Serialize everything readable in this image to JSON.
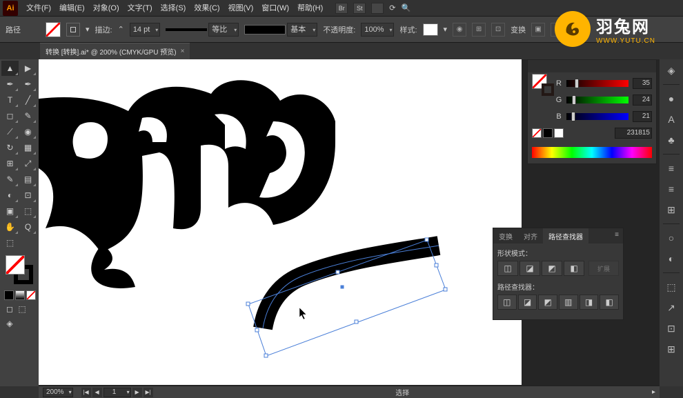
{
  "app_icon": "Ai",
  "menu": [
    "文件(F)",
    "编辑(E)",
    "对象(O)",
    "文字(T)",
    "选择(S)",
    "效果(C)",
    "视图(V)",
    "窗口(W)",
    "帮助(H)"
  ],
  "menu_extra_labels": [
    "Br",
    "St"
  ],
  "options": {
    "label": "路径",
    "stroke_label": "描边:",
    "stroke_weight": "14 pt",
    "profile_label": "等比",
    "brush_label": "基本",
    "opacity_label": "不透明度:",
    "opacity_value": "100%",
    "style_label": "样式:",
    "transform_label": "变换"
  },
  "tab": {
    "title": "转换  [转换].ai* @ 200% (CMYK/GPU 预览)",
    "close": "×"
  },
  "tools": [
    [
      "▲",
      "▶"
    ],
    [
      "✒",
      "✒"
    ],
    [
      "T",
      "╱"
    ],
    [
      "◻",
      "✎"
    ],
    [
      "⟋",
      "◉"
    ],
    [
      "↻",
      "▦"
    ],
    [
      "⊞",
      "⤢"
    ],
    [
      "✎",
      "▤"
    ],
    [
      "◐",
      "⊡"
    ],
    [
      "▣",
      "⬚"
    ],
    [
      "✋",
      "Q"
    ],
    [
      "⬚",
      ""
    ]
  ],
  "toolbox_small": {
    "color": "",
    "grad": "",
    "none": ""
  },
  "toolbox_bottom": [
    "◻",
    "⬚",
    "◈"
  ],
  "color_panel": {
    "channels": [
      {
        "ch": "R",
        "val": "35",
        "pos": "13%"
      },
      {
        "ch": "G",
        "val": "24",
        "pos": "9%"
      },
      {
        "ch": "B",
        "val": "21",
        "pos": "8%"
      }
    ],
    "hex": "231815"
  },
  "pathfinder": {
    "tabs": [
      "变换",
      "对齐",
      "路径查找器"
    ],
    "shape_mode": "形状模式：",
    "expand": "扩展",
    "path": "路径查找器：",
    "sm_icons": [
      "◫",
      "◪",
      "◩",
      "◧"
    ],
    "pf_icons": [
      "◫",
      "◪",
      "◩",
      "▥",
      "◨",
      "◧"
    ]
  },
  "status": {
    "zoom": "200%",
    "artboard": "1",
    "nav": [
      "|◀",
      "◀",
      "▶",
      "▶|"
    ],
    "tool": "选择"
  },
  "dock_icons": [
    "◈",
    "●",
    "A",
    "♣",
    "≡",
    "≡",
    "⊞",
    "○",
    "◐",
    "⬚",
    "↗",
    "⊡",
    "⊞"
  ],
  "watermark": {
    "main": "羽兔网",
    "sub": "WWW.YUTU.CN"
  }
}
